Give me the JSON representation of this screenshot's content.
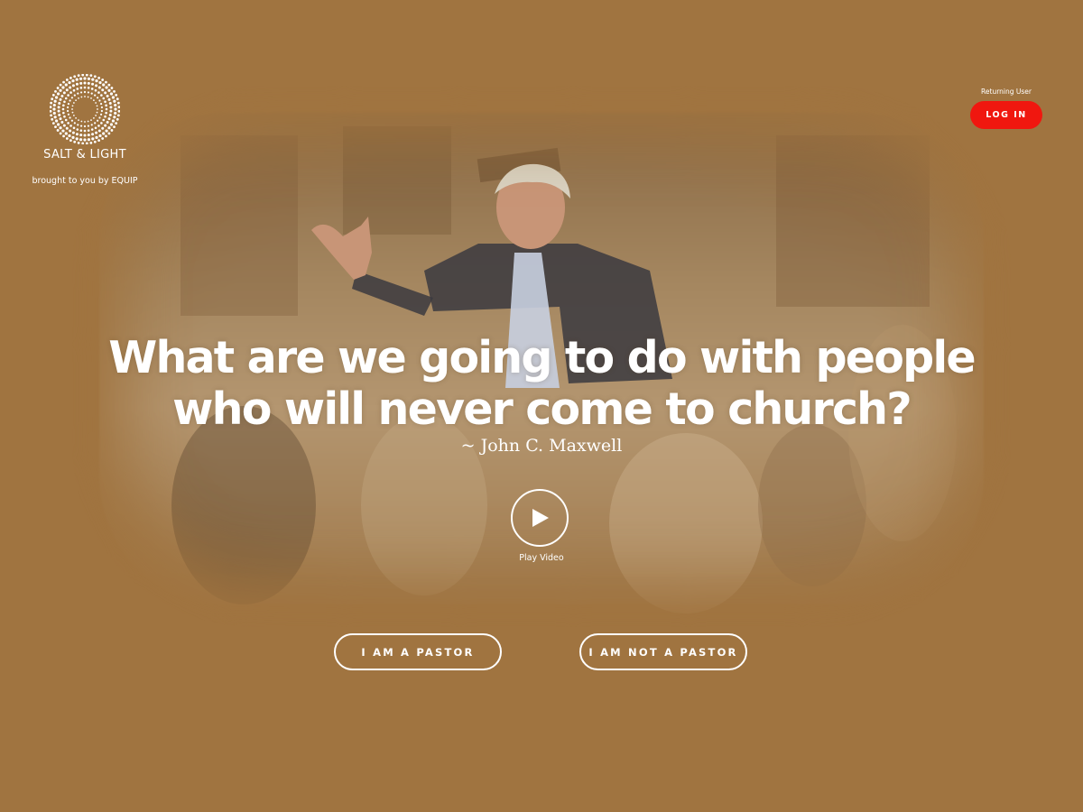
{
  "brand": {
    "name": "SALT & LIGHT",
    "tagline": "brought to you by EQUIP",
    "logo_icon": "dotted-sunburst-icon"
  },
  "login": {
    "label": "Returning User",
    "button": "LOG IN",
    "button_color": "#f0170f"
  },
  "hero": {
    "quote_line1": "What are we going to do with people",
    "quote_line2": "who will never come to church?",
    "attribution": "~ John C. Maxwell",
    "play_icon": "play-icon",
    "play_label": "Play Video"
  },
  "choices": {
    "pastor": "I AM A PASTOR",
    "not_pastor": "I AM NOT A PASTOR"
  },
  "colors": {
    "background": "#a07440",
    "text": "#ffffff"
  }
}
